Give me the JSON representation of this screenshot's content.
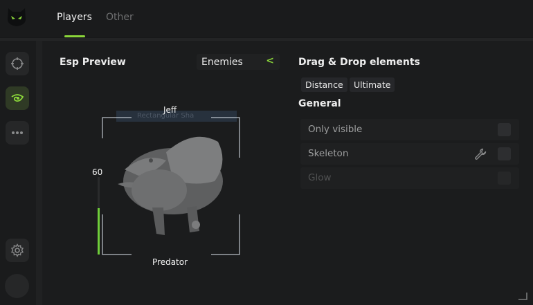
{
  "tabs": [
    {
      "label": "Players",
      "active": true
    },
    {
      "label": "Other",
      "active": false
    }
  ],
  "colors": {
    "accent": "#8bd63a",
    "health_bar": "#6fcd3a",
    "background": "#171819",
    "panel": "#1b1c1d"
  },
  "sidebar": {
    "items": [
      {
        "icon": "crosshair-icon",
        "active": false
      },
      {
        "icon": "eye-icon",
        "active": true
      },
      {
        "icon": "more-icon",
        "active": false
      }
    ],
    "bottom": [
      {
        "icon": "gear-icon"
      },
      {
        "icon": "avatar"
      }
    ]
  },
  "esp_preview": {
    "title": "Esp Preview",
    "target_select": {
      "value": "Enemies",
      "arrow": "<"
    },
    "player_name": "Jeff",
    "player_class": "Predator",
    "health_value": "60",
    "health_fraction": 0.6,
    "overlay_text": "Rectangular Sha"
  },
  "drag_drop": {
    "title": "Drag & Drop elements",
    "chips": [
      "Distance",
      "Ultimate"
    ]
  },
  "general": {
    "title": "General",
    "options": [
      {
        "label": "Only visible",
        "enabled": true,
        "checked": false,
        "has_settings": false
      },
      {
        "label": "Skeleton",
        "enabled": true,
        "checked": false,
        "has_settings": true
      },
      {
        "label": "Glow",
        "enabled": false,
        "checked": false,
        "has_settings": false
      }
    ]
  }
}
